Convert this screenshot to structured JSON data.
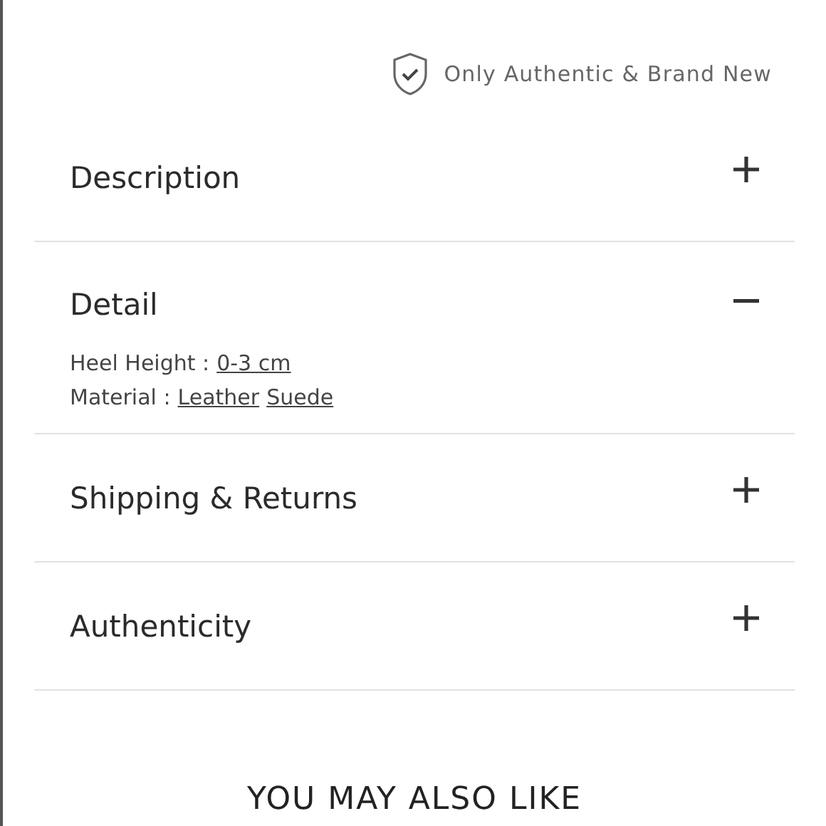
{
  "badge": {
    "text": "Only Authentic & Brand New"
  },
  "sections": [
    {
      "title": "Description",
      "expanded": false
    },
    {
      "title": "Detail",
      "expanded": true,
      "details": [
        {
          "label": "Heel Height :",
          "values": [
            "0-3 cm"
          ]
        },
        {
          "label": "Material :",
          "values": [
            "Leather",
            "Suede"
          ]
        }
      ]
    },
    {
      "title": "Shipping & Returns",
      "expanded": false
    },
    {
      "title": "Authenticity",
      "expanded": false
    }
  ],
  "recommendations": {
    "heading": "YOU MAY ALSO LIKE"
  }
}
